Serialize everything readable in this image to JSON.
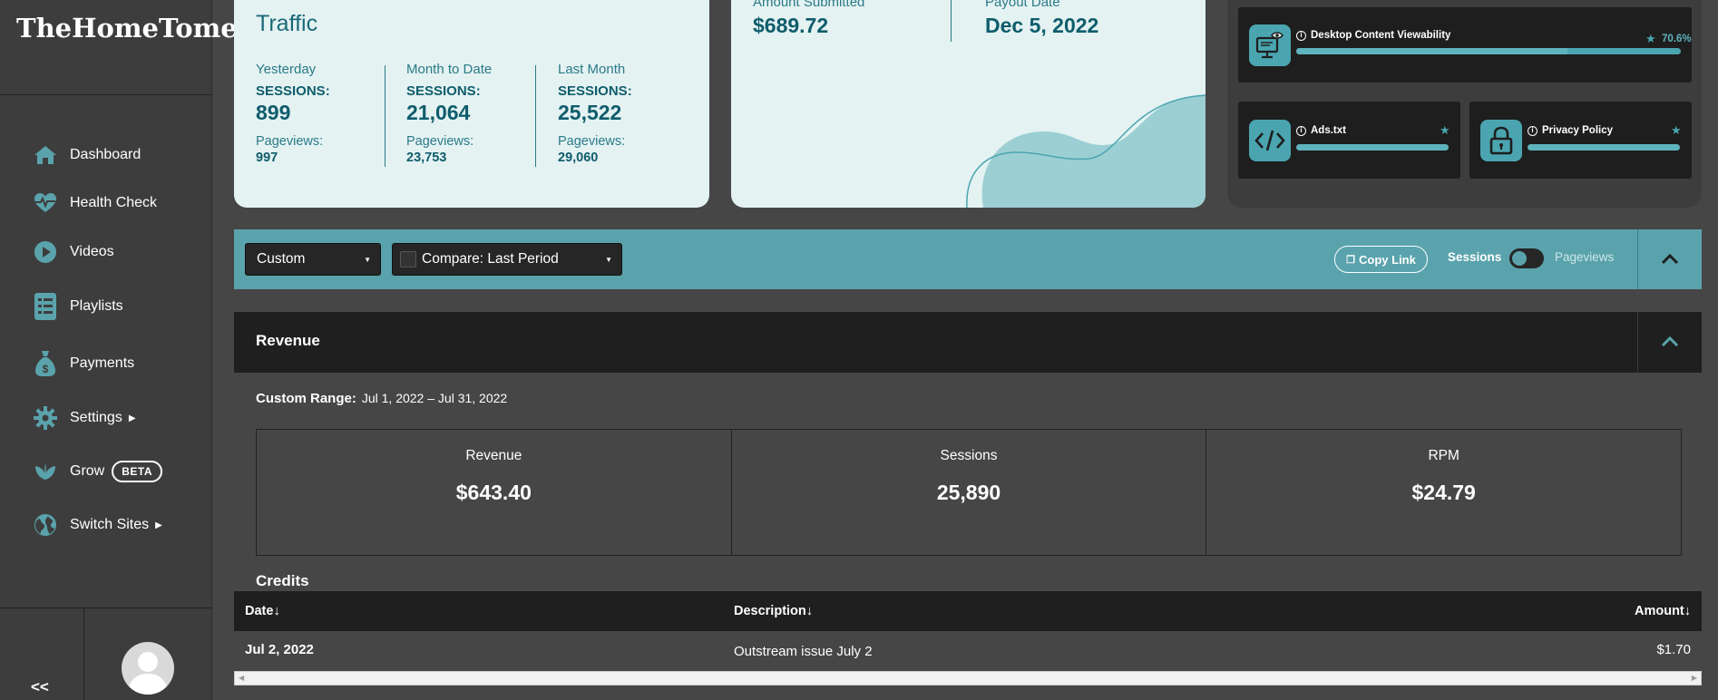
{
  "sidebar": {
    "logo": "TheHomeTome",
    "items": [
      {
        "label": "Dashboard"
      },
      {
        "label": "Health Check"
      },
      {
        "label": "Videos"
      },
      {
        "label": "Playlists"
      },
      {
        "label": "Payments"
      },
      {
        "label": "Settings"
      },
      {
        "label": "Grow",
        "badge": "BETA"
      },
      {
        "label": "Switch Sites"
      }
    ],
    "collapse_label": "<<"
  },
  "traffic": {
    "title": "Traffic",
    "columns": [
      {
        "period": "Yesterday",
        "sessions_label": "SESSIONS:",
        "sessions": "899",
        "pageviews_label": "Pageviews:",
        "pageviews": "997"
      },
      {
        "period": "Month to Date",
        "sessions_label": "SESSIONS:",
        "sessions": "21,064",
        "pageviews_label": "Pageviews:",
        "pageviews": "23,753"
      },
      {
        "period": "Last Month",
        "sessions_label": "SESSIONS:",
        "sessions": "25,522",
        "pageviews_label": "Pageviews:",
        "pageviews": "29,060"
      }
    ]
  },
  "payout": {
    "amount_label": "Amount Submitted",
    "amount": "$689.72",
    "date_label": "Payout Date",
    "date": "Dec 5, 2022"
  },
  "health": {
    "items": [
      {
        "name": "Desktop Content Viewability",
        "score": "70.6%",
        "icon": "monitor-eye-icon",
        "fill": 0.706
      },
      {
        "name": "Ads.txt",
        "icon": "code-icon",
        "fill": 1.0
      },
      {
        "name": "Privacy Policy",
        "icon": "lock-icon",
        "fill": 1.0
      }
    ]
  },
  "toolbar": {
    "range_select": "Custom",
    "compare_select": "Compare: Last Period",
    "copy_link": "Copy Link",
    "toggle_left": "Sessions",
    "toggle_right": "Pageviews"
  },
  "revenue": {
    "title": "Revenue",
    "range_label": "Custom Range:",
    "range_value": "Jul 1, 2022 – Jul 31, 2022",
    "stats": [
      {
        "label": "Revenue",
        "value": "$643.40"
      },
      {
        "label": "Sessions",
        "value": "25,890"
      },
      {
        "label": "RPM",
        "value": "$24.79"
      }
    ],
    "credits_title": "Credits",
    "columns": [
      "Date",
      "Description",
      "Amount"
    ],
    "rows": [
      {
        "date": "Jul 2, 2022",
        "description": "Outstream issue July 2",
        "amount": "$1.70"
      }
    ]
  },
  "colors": {
    "accent": "#5aa3ac",
    "card_bg": "#e4f2f2",
    "dark_bg": "#1f1f1f",
    "page_bg": "#464646"
  }
}
